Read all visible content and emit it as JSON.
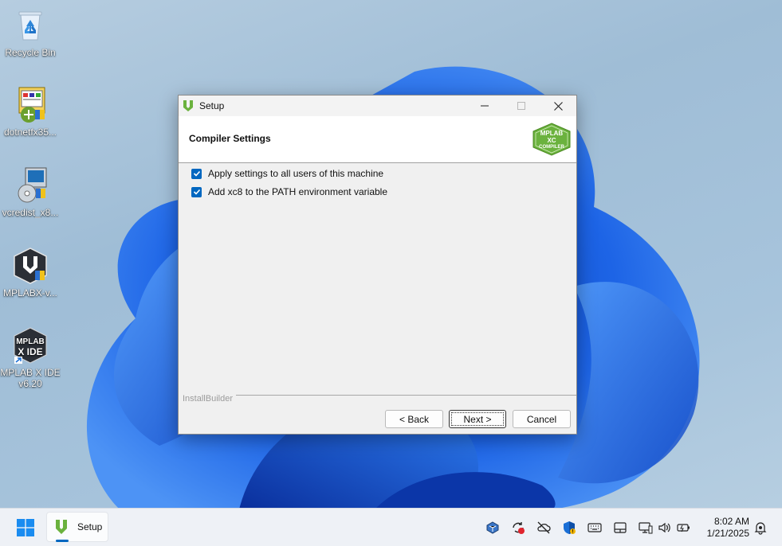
{
  "desktop": {
    "icons": [
      {
        "label": "Recycle Bin",
        "icon": "recycle-bin-icon"
      },
      {
        "label": "dotnetfx35...",
        "icon": "installer-icon"
      },
      {
        "label": "vcredist_x8...",
        "icon": "installer-disc-icon"
      },
      {
        "label": "MPLABX-v...",
        "icon": "mplab-setup-icon"
      },
      {
        "label": "MPLAB X IDE",
        "label2": "v6.20",
        "icon": "mplab-ide-icon"
      }
    ]
  },
  "dialog": {
    "title": "Setup",
    "heading": "Compiler Settings",
    "logo": {
      "line1": "MPLAB",
      "line2": "XC",
      "line3": "COMPILER"
    },
    "options": [
      {
        "label": "Apply settings to all users of this machine",
        "checked": true
      },
      {
        "label": "Add xc8 to the PATH environment variable",
        "checked": true
      }
    ],
    "branding": "InstallBuilder",
    "buttons": {
      "back": "< Back",
      "next": "Next >",
      "cancel": "Cancel"
    }
  },
  "taskbar": {
    "app_label": "Setup",
    "clock": {
      "time": "8:02 AM",
      "date": "1/21/2025"
    }
  },
  "colors": {
    "accent": "#0067c0",
    "mplab_green": "#6bb23e",
    "wallpaper_blue": "#1a5fe0"
  }
}
